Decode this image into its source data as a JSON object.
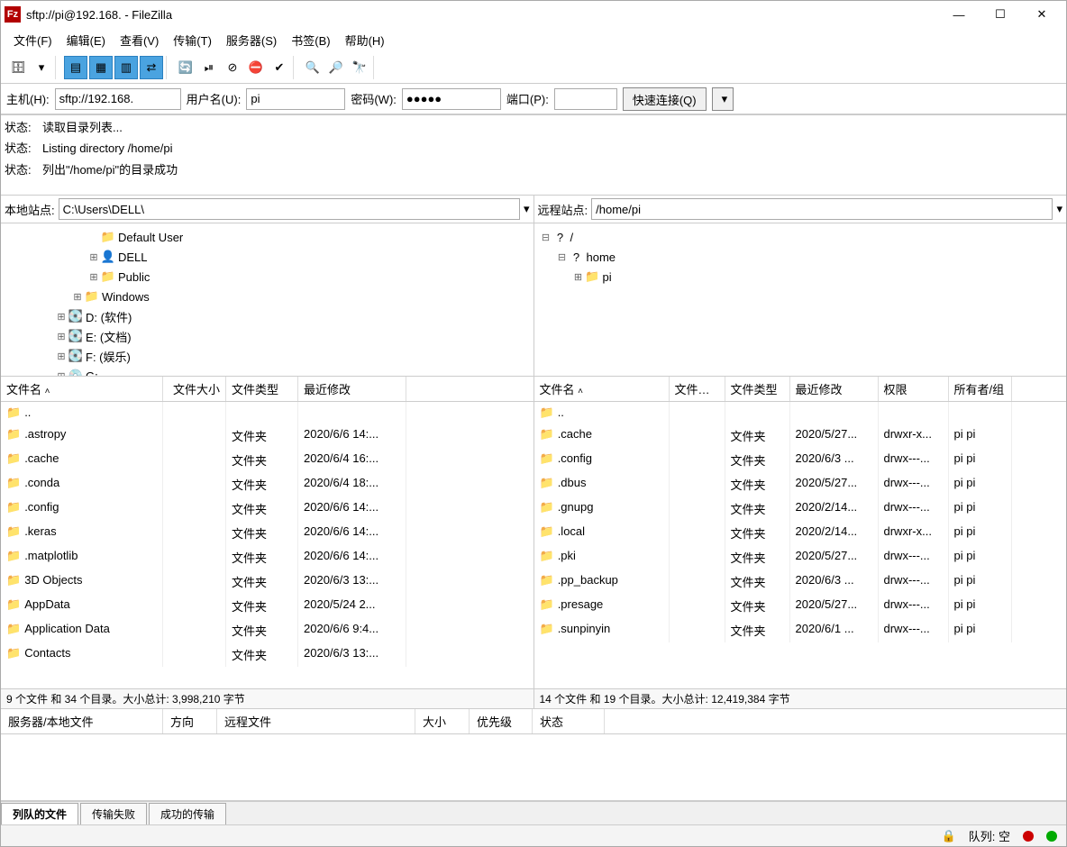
{
  "title": "sftp://pi@192.168.       - FileZilla",
  "menus": [
    "文件(F)",
    "编辑(E)",
    "查看(V)",
    "传输(T)",
    "服务器(S)",
    "书签(B)",
    "帮助(H)"
  ],
  "quick": {
    "host_label": "主机(H):",
    "host": "sftp://192.168.",
    "user_label": "用户名(U):",
    "user": "pi",
    "pass_label": "密码(W):",
    "pass": "●●●●●",
    "port_label": "端口(P):",
    "port": "",
    "connect": "快速连接(Q)"
  },
  "log": [
    {
      "tag": "状态:",
      "msg": "读取目录列表..."
    },
    {
      "tag": "状态:",
      "msg": "Listing directory /home/pi"
    },
    {
      "tag": "状态:",
      "msg": "列出\"/home/pi\"的目录成功"
    }
  ],
  "local": {
    "site_label": "本地站点:",
    "path": "C:\\Users\\DELL\\",
    "tree": [
      {
        "indent": 5,
        "exp": "",
        "icon": "📁",
        "label": "Default User"
      },
      {
        "indent": 5,
        "exp": "⊞",
        "icon": "👤",
        "label": "DELL"
      },
      {
        "indent": 5,
        "exp": "⊞",
        "icon": "📁",
        "label": "Public"
      },
      {
        "indent": 4,
        "exp": "⊞",
        "icon": "📁",
        "label": "Windows"
      },
      {
        "indent": 3,
        "exp": "⊞",
        "icon": "💽",
        "label": "D: (软件)"
      },
      {
        "indent": 3,
        "exp": "⊞",
        "icon": "💽",
        "label": "E: (文档)"
      },
      {
        "indent": 3,
        "exp": "⊞",
        "icon": "💽",
        "label": "F: (娱乐)"
      },
      {
        "indent": 3,
        "exp": "⊞",
        "icon": "💿",
        "label": "G:"
      }
    ],
    "cols": [
      "文件名",
      "文件大小",
      "文件类型",
      "最近修改"
    ],
    "files": [
      {
        "name": "..",
        "size": "",
        "type": "",
        "mod": ""
      },
      {
        "name": ".astropy",
        "size": "",
        "type": "文件夹",
        "mod": "2020/6/6 14:..."
      },
      {
        "name": ".cache",
        "size": "",
        "type": "文件夹",
        "mod": "2020/6/4 16:..."
      },
      {
        "name": ".conda",
        "size": "",
        "type": "文件夹",
        "mod": "2020/6/4 18:..."
      },
      {
        "name": ".config",
        "size": "",
        "type": "文件夹",
        "mod": "2020/6/6 14:..."
      },
      {
        "name": ".keras",
        "size": "",
        "type": "文件夹",
        "mod": "2020/6/6 14:..."
      },
      {
        "name": ".matplotlib",
        "size": "",
        "type": "文件夹",
        "mod": "2020/6/6 14:..."
      },
      {
        "name": "3D Objects",
        "size": "",
        "type": "文件夹",
        "mod": "2020/6/3 13:..."
      },
      {
        "name": "AppData",
        "size": "",
        "type": "文件夹",
        "mod": "2020/5/24 2..."
      },
      {
        "name": "Application Data",
        "size": "",
        "type": "文件夹",
        "mod": "2020/6/6 9:4..."
      },
      {
        "name": "Contacts",
        "size": "",
        "type": "文件夹",
        "mod": "2020/6/3 13:..."
      }
    ],
    "status": "9 个文件 和 34 个目录。大小总计: 3,998,210 字节"
  },
  "remote": {
    "site_label": "远程站点:",
    "path": "/home/pi",
    "tree": [
      {
        "indent": 0,
        "exp": "⊟",
        "icon": "?",
        "label": "/"
      },
      {
        "indent": 1,
        "exp": "⊟",
        "icon": "?",
        "label": "home"
      },
      {
        "indent": 2,
        "exp": "⊞",
        "icon": "📁",
        "label": "pi"
      }
    ],
    "cols": [
      "文件名",
      "文件大小",
      "文件类型",
      "最近修改",
      "权限",
      "所有者/组"
    ],
    "files": [
      {
        "name": "..",
        "size": "",
        "type": "",
        "mod": "",
        "perm": "",
        "owner": ""
      },
      {
        "name": ".cache",
        "size": "",
        "type": "文件夹",
        "mod": "2020/5/27...",
        "perm": "drwxr-x...",
        "owner": "pi pi"
      },
      {
        "name": ".config",
        "size": "",
        "type": "文件夹",
        "mod": "2020/6/3 ...",
        "perm": "drwx---...",
        "owner": "pi pi"
      },
      {
        "name": ".dbus",
        "size": "",
        "type": "文件夹",
        "mod": "2020/5/27...",
        "perm": "drwx---...",
        "owner": "pi pi"
      },
      {
        "name": ".gnupg",
        "size": "",
        "type": "文件夹",
        "mod": "2020/2/14...",
        "perm": "drwx---...",
        "owner": "pi pi"
      },
      {
        "name": ".local",
        "size": "",
        "type": "文件夹",
        "mod": "2020/2/14...",
        "perm": "drwxr-x...",
        "owner": "pi pi"
      },
      {
        "name": ".pki",
        "size": "",
        "type": "文件夹",
        "mod": "2020/5/27...",
        "perm": "drwx---...",
        "owner": "pi pi"
      },
      {
        "name": ".pp_backup",
        "size": "",
        "type": "文件夹",
        "mod": "2020/6/3 ...",
        "perm": "drwx---...",
        "owner": "pi pi"
      },
      {
        "name": ".presage",
        "size": "",
        "type": "文件夹",
        "mod": "2020/5/27...",
        "perm": "drwx---...",
        "owner": "pi pi"
      },
      {
        "name": ".sunpinyin",
        "size": "",
        "type": "文件夹",
        "mod": "2020/6/1 ...",
        "perm": "drwx---...",
        "owner": "pi pi"
      }
    ],
    "status": "14 个文件 和 19 个目录。大小总计: 12,419,384 字节"
  },
  "queue_cols": [
    "服务器/本地文件",
    "方向",
    "远程文件",
    "大小",
    "优先级",
    "状态"
  ],
  "tabs": [
    "列队的文件",
    "传输失败",
    "成功的传输"
  ],
  "statusbar": {
    "queue": "队列: 空"
  }
}
